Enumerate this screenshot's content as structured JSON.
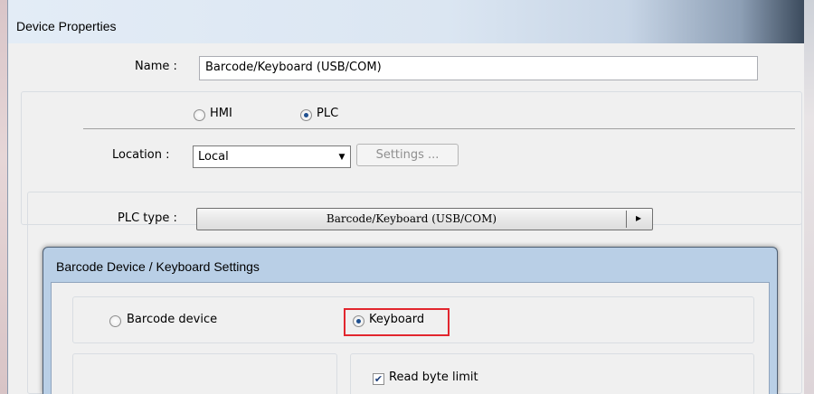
{
  "window": {
    "title": "Device Properties"
  },
  "name_field": {
    "label": "Name :",
    "value": "Barcode/Keyboard (USB/COM)"
  },
  "device_kind": {
    "hmi_label": "HMI",
    "plc_label": "PLC",
    "selected": "PLC"
  },
  "location": {
    "label": "Location :",
    "value": "Local",
    "settings_label": "Settings ..."
  },
  "plc_type": {
    "label": "PLC type :",
    "value": "Barcode/Keyboard (USB/COM)",
    "arrow": "▸"
  },
  "dialog": {
    "title": "Barcode Device / Keyboard Settings",
    "barcode_label": "Barcode device",
    "keyboard_label": "Keyboard",
    "selected": "Keyboard",
    "read_byte_limit_label": "Read byte limit",
    "read_byte_limit_checked": true
  },
  "colors": {
    "highlight": "#e2262e",
    "dialog_frame": "#b9cfe6"
  },
  "icons": {
    "combo": "chevron-down-icon",
    "plc": "play-arrow-icon",
    "check": "checkmark-icon"
  }
}
